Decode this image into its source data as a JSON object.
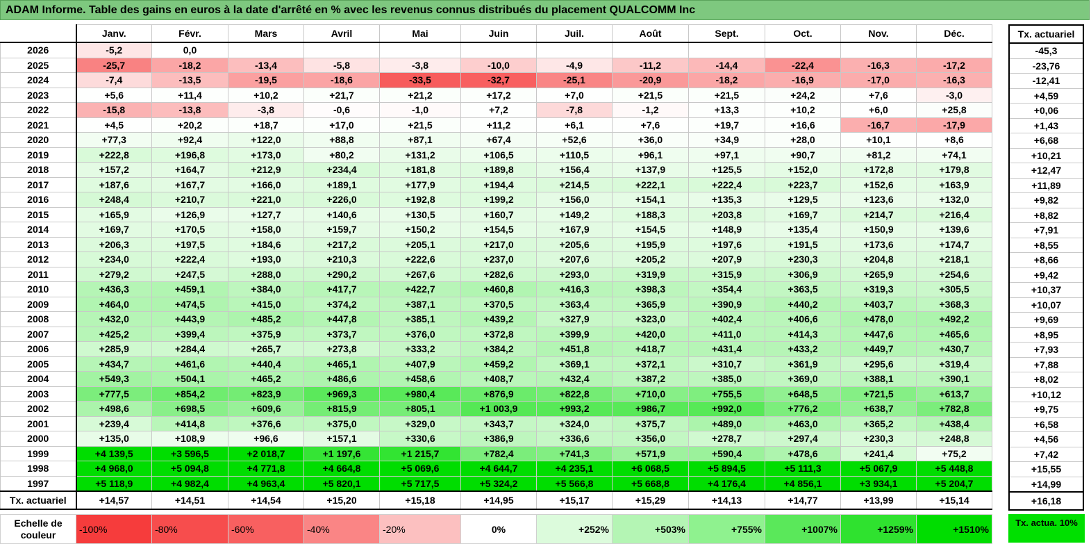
{
  "title": "ADAM Informe. Table des gains en euros à la date d'arrêté en % avec les revenus connus distribués du placement QUALCOMM Inc",
  "months": [
    "Janv.",
    "Févr.",
    "Mars",
    "Avril",
    "Mai",
    "Juin",
    "Juil.",
    "Août",
    "Sept.",
    "Oct.",
    "Nov.",
    "Déc."
  ],
  "actuarial_header": "Tx. actuariel",
  "rows": [
    {
      "year": "2026",
      "values": [
        "-5,2",
        "0,0",
        "",
        "",
        "",
        "",
        "",
        "",
        "",
        "",
        "",
        ""
      ],
      "act": "-45,3"
    },
    {
      "year": "2025",
      "values": [
        "-25,7",
        "-18,2",
        "-13,4",
        "-5,8",
        "-3,8",
        "-10,0",
        "-4,9",
        "-11,2",
        "-14,4",
        "-22,4",
        "-16,3",
        "-17,2"
      ],
      "act": "-23,76"
    },
    {
      "year": "2024",
      "values": [
        "-7,4",
        "-13,5",
        "-19,5",
        "-18,6",
        "-33,5",
        "-32,7",
        "-25,1",
        "-20,9",
        "-18,2",
        "-16,9",
        "-17,0",
        "-16,3"
      ],
      "act": "-12,41"
    },
    {
      "year": "2023",
      "values": [
        "+5,6",
        "+11,4",
        "+10,2",
        "+21,7",
        "+21,2",
        "+17,2",
        "+7,0",
        "+21,5",
        "+21,5",
        "+24,2",
        "+7,6",
        "-3,0"
      ],
      "act": "+4,59"
    },
    {
      "year": "2022",
      "values": [
        "-15,8",
        "-13,8",
        "-3,8",
        "-0,6",
        "-1,0",
        "+7,2",
        "-7,8",
        "-1,2",
        "+13,3",
        "+10,2",
        "+6,0",
        "+25,8"
      ],
      "act": "+0,06"
    },
    {
      "year": "2021",
      "values": [
        "+4,5",
        "+20,2",
        "+18,7",
        "+17,0",
        "+21,5",
        "+11,2",
        "+6,1",
        "+7,6",
        "+19,7",
        "+16,6",
        "-16,7",
        "-17,9"
      ],
      "act": "+1,43"
    },
    {
      "year": "2020",
      "values": [
        "+77,3",
        "+92,4",
        "+122,0",
        "+88,8",
        "+87,1",
        "+67,4",
        "+52,6",
        "+36,0",
        "+34,9",
        "+28,0",
        "+10,1",
        "+8,6"
      ],
      "act": "+6,68"
    },
    {
      "year": "2019",
      "values": [
        "+222,8",
        "+196,8",
        "+173,0",
        "+80,2",
        "+131,2",
        "+106,5",
        "+110,5",
        "+96,1",
        "+97,1",
        "+90,7",
        "+81,2",
        "+74,1"
      ],
      "act": "+10,21"
    },
    {
      "year": "2018",
      "values": [
        "+157,2",
        "+164,7",
        "+212,9",
        "+234,4",
        "+181,8",
        "+189,8",
        "+156,4",
        "+137,9",
        "+125,5",
        "+152,0",
        "+172,8",
        "+179,8"
      ],
      "act": "+12,47"
    },
    {
      "year": "2017",
      "values": [
        "+187,6",
        "+167,7",
        "+166,0",
        "+189,1",
        "+177,9",
        "+194,4",
        "+214,5",
        "+222,1",
        "+222,4",
        "+223,7",
        "+152,6",
        "+163,9"
      ],
      "act": "+11,89"
    },
    {
      "year": "2016",
      "values": [
        "+248,4",
        "+210,7",
        "+221,0",
        "+226,0",
        "+192,8",
        "+199,2",
        "+156,0",
        "+154,1",
        "+135,3",
        "+129,5",
        "+123,6",
        "+132,0"
      ],
      "act": "+9,82"
    },
    {
      "year": "2015",
      "values": [
        "+165,9",
        "+126,9",
        "+127,7",
        "+140,6",
        "+130,5",
        "+160,7",
        "+149,2",
        "+188,3",
        "+203,8",
        "+169,7",
        "+214,7",
        "+216,4"
      ],
      "act": "+8,82"
    },
    {
      "year": "2014",
      "values": [
        "+169,7",
        "+170,5",
        "+158,0",
        "+159,7",
        "+150,2",
        "+154,5",
        "+167,9",
        "+154,5",
        "+148,9",
        "+135,4",
        "+150,9",
        "+139,6"
      ],
      "act": "+7,91"
    },
    {
      "year": "2013",
      "values": [
        "+206,3",
        "+197,5",
        "+184,6",
        "+217,2",
        "+205,1",
        "+217,0",
        "+205,6",
        "+195,9",
        "+197,6",
        "+191,5",
        "+173,6",
        "+174,7"
      ],
      "act": "+8,55"
    },
    {
      "year": "2012",
      "values": [
        "+234,0",
        "+222,4",
        "+193,0",
        "+210,3",
        "+222,6",
        "+237,0",
        "+207,6",
        "+205,2",
        "+207,9",
        "+230,3",
        "+204,8",
        "+218,1"
      ],
      "act": "+8,66"
    },
    {
      "year": "2011",
      "values": [
        "+279,2",
        "+247,5",
        "+288,0",
        "+290,2",
        "+267,6",
        "+282,6",
        "+293,0",
        "+319,9",
        "+315,9",
        "+306,9",
        "+265,9",
        "+254,6"
      ],
      "act": "+9,42"
    },
    {
      "year": "2010",
      "values": [
        "+436,3",
        "+459,1",
        "+384,0",
        "+417,7",
        "+422,7",
        "+460,8",
        "+416,3",
        "+398,3",
        "+354,4",
        "+363,5",
        "+319,3",
        "+305,5"
      ],
      "act": "+10,37"
    },
    {
      "year": "2009",
      "values": [
        "+464,0",
        "+474,5",
        "+415,0",
        "+374,2",
        "+387,1",
        "+370,5",
        "+363,4",
        "+365,9",
        "+390,9",
        "+440,2",
        "+403,7",
        "+368,3"
      ],
      "act": "+10,07"
    },
    {
      "year": "2008",
      "values": [
        "+432,0",
        "+443,9",
        "+485,2",
        "+447,8",
        "+385,1",
        "+439,2",
        "+327,9",
        "+323,0",
        "+402,4",
        "+406,6",
        "+478,0",
        "+492,2"
      ],
      "act": "+9,69"
    },
    {
      "year": "2007",
      "values": [
        "+425,2",
        "+399,4",
        "+375,9",
        "+373,7",
        "+376,0",
        "+372,8",
        "+399,9",
        "+420,0",
        "+411,0",
        "+414,3",
        "+447,6",
        "+465,6"
      ],
      "act": "+8,95"
    },
    {
      "year": "2006",
      "values": [
        "+285,9",
        "+284,4",
        "+265,7",
        "+273,8",
        "+333,2",
        "+384,2",
        "+451,8",
        "+418,7",
        "+431,4",
        "+433,2",
        "+449,7",
        "+430,7"
      ],
      "act": "+7,93"
    },
    {
      "year": "2005",
      "values": [
        "+434,7",
        "+461,6",
        "+440,4",
        "+465,1",
        "+407,9",
        "+459,2",
        "+369,1",
        "+372,1",
        "+310,7",
        "+361,9",
        "+295,6",
        "+319,4"
      ],
      "act": "+7,88"
    },
    {
      "year": "2004",
      "values": [
        "+549,3",
        "+504,1",
        "+465,2",
        "+486,6",
        "+458,6",
        "+408,7",
        "+432,4",
        "+387,2",
        "+385,0",
        "+369,0",
        "+388,1",
        "+390,1"
      ],
      "act": "+8,02"
    },
    {
      "year": "2003",
      "values": [
        "+777,5",
        "+854,2",
        "+823,9",
        "+969,3",
        "+980,4",
        "+876,9",
        "+822,8",
        "+710,0",
        "+755,5",
        "+648,5",
        "+721,5",
        "+613,7"
      ],
      "act": "+10,12"
    },
    {
      "year": "2002",
      "values": [
        "+498,6",
        "+698,5",
        "+609,6",
        "+815,9",
        "+805,1",
        "+1 003,9",
        "+993,2",
        "+986,7",
        "+992,0",
        "+776,2",
        "+638,7",
        "+782,8"
      ],
      "act": "+9,75"
    },
    {
      "year": "2001",
      "values": [
        "+239,4",
        "+414,8",
        "+376,6",
        "+375,0",
        "+329,0",
        "+343,7",
        "+324,0",
        "+375,7",
        "+489,0",
        "+463,0",
        "+365,2",
        "+438,4"
      ],
      "act": "+6,58"
    },
    {
      "year": "2000",
      "values": [
        "+135,0",
        "+108,9",
        "+96,6",
        "+157,1",
        "+330,6",
        "+386,9",
        "+336,6",
        "+356,0",
        "+278,7",
        "+297,4",
        "+230,3",
        "+248,8"
      ],
      "act": "+4,56"
    },
    {
      "year": "1999",
      "values": [
        "+4 139,5",
        "+3 596,5",
        "+2 018,7",
        "+1 197,6",
        "+1 215,7",
        "+782,4",
        "+741,3",
        "+571,9",
        "+590,4",
        "+478,6",
        "+241,4",
        "+75,2"
      ],
      "act": "+7,42"
    },
    {
      "year": "1998",
      "values": [
        "+4 968,0",
        "+5 094,8",
        "+4 771,8",
        "+4 664,8",
        "+5 069,6",
        "+4 644,7",
        "+4 235,1",
        "+6 068,5",
        "+5 894,5",
        "+5 111,3",
        "+5 067,9",
        "+5 448,8"
      ],
      "act": "+15,55"
    },
    {
      "year": "1997",
      "values": [
        "+5 118,9",
        "+4 982,4",
        "+4 963,4",
        "+5 820,1",
        "+5 717,5",
        "+5 324,2",
        "+5 566,8",
        "+5 668,8",
        "+4 176,4",
        "+4 856,1",
        "+3 934,1",
        "+5 204,7"
      ],
      "act": "+14,99"
    }
  ],
  "footer": {
    "label": "Tx. actuariel",
    "values": [
      "+14,57",
      "+14,51",
      "+14,54",
      "+15,20",
      "+15,18",
      "+14,95",
      "+15,17",
      "+15,29",
      "+14,13",
      "+14,77",
      "+13,99",
      "+15,14"
    ],
    "act": "+16,18"
  },
  "scale": {
    "label": "Echelle de couleur",
    "steps": [
      {
        "text": "-100%",
        "color": "#f63c3c"
      },
      {
        "text": "-80%",
        "color": "#f74d4d"
      },
      {
        "text": "-60%",
        "color": "#f86060"
      },
      {
        "text": "-40%",
        "color": "#fa8585"
      },
      {
        "text": "-20%",
        "color": "#fcc0c0"
      },
      {
        "text": "0%",
        "color": "#ffffff"
      },
      {
        "text": "+252%",
        "color": "#dcfbdc"
      },
      {
        "text": "+503%",
        "color": "#b4f5b4"
      },
      {
        "text": "+755%",
        "color": "#8ff28f"
      },
      {
        "text": "+1007%",
        "color": "#5ae85a"
      },
      {
        "text": "+1259%",
        "color": "#2fe22f"
      },
      {
        "text": "+1510%",
        "color": "#00dd00"
      }
    ],
    "act_label": "Tx. actua. 10%",
    "act_color": "#00e000"
  }
}
